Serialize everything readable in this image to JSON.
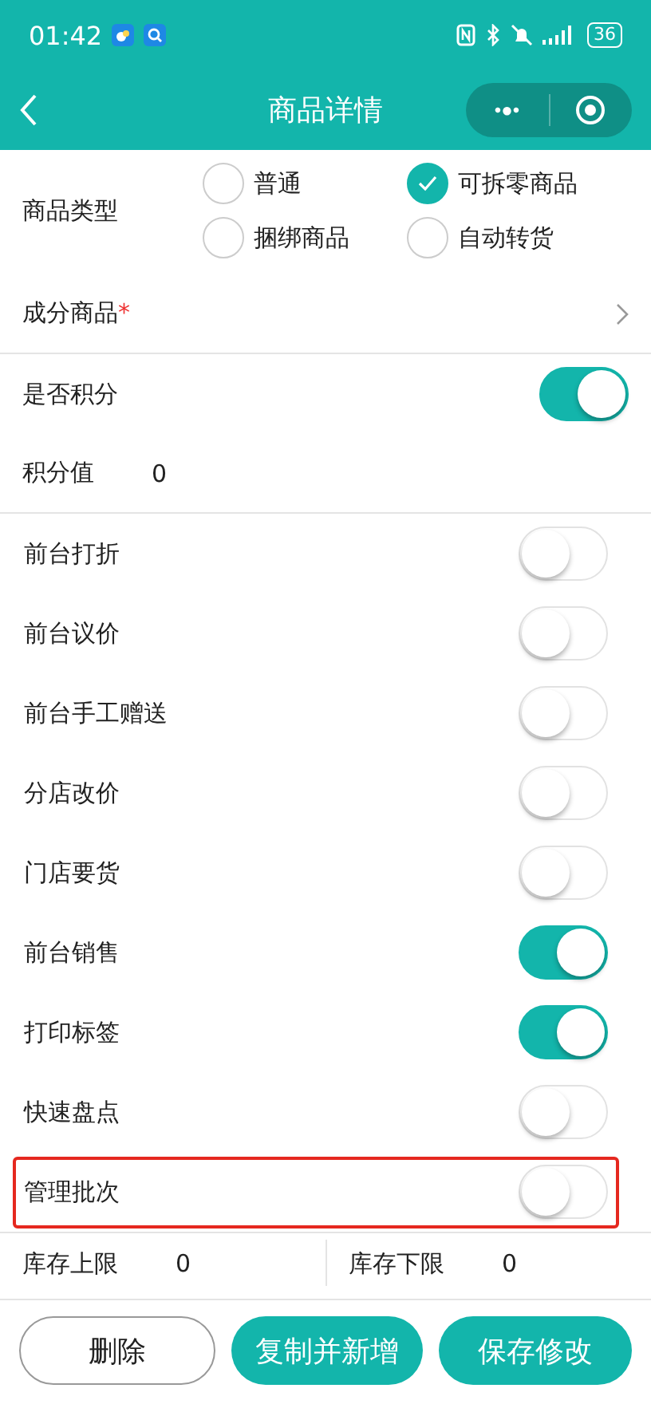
{
  "status_bar": {
    "time": "01:42",
    "battery": "36"
  },
  "nav": {
    "title": "商品详情",
    "more_icon": "•●•"
  },
  "product_type": {
    "label": "商品类型",
    "options": [
      {
        "label": "普通",
        "selected": false
      },
      {
        "label": "可拆零商品",
        "selected": true
      },
      {
        "label": "捆绑商品",
        "selected": false
      },
      {
        "label": "自动转货",
        "selected": false
      }
    ]
  },
  "component": {
    "label": "成分商品",
    "required_mark": "*"
  },
  "points": {
    "label": "是否积分",
    "on": true
  },
  "points_value": {
    "label": "积分值",
    "value": "0"
  },
  "switches": [
    {
      "label": "前台打折",
      "on": false,
      "highlighted": false
    },
    {
      "label": "前台议价",
      "on": false,
      "highlighted": false
    },
    {
      "label": "前台手工赠送",
      "on": false,
      "highlighted": false
    },
    {
      "label": "分店改价",
      "on": false,
      "highlighted": false
    },
    {
      "label": "门店要货",
      "on": false,
      "highlighted": false
    },
    {
      "label": "前台销售",
      "on": true,
      "highlighted": false
    },
    {
      "label": "打印标签",
      "on": true,
      "highlighted": false
    },
    {
      "label": "快速盘点",
      "on": false,
      "highlighted": false
    },
    {
      "label": "管理批次",
      "on": false,
      "highlighted": true
    }
  ],
  "stock": [
    {
      "label": "库存上限",
      "value": "0"
    },
    {
      "label": "库存下限",
      "value": "0"
    }
  ],
  "buttons": [
    {
      "kind": "outline",
      "label": "删除"
    },
    {
      "kind": "filled",
      "label": "复制并新增"
    },
    {
      "kind": "filled",
      "label": "保存修改"
    }
  ]
}
